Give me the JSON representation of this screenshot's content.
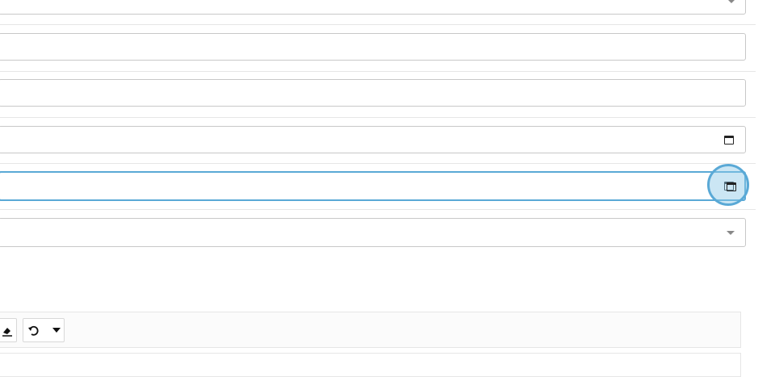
{
  "form": {
    "fields": [
      {
        "type": "select",
        "value": ""
      },
      {
        "type": "text",
        "value": ""
      },
      {
        "type": "text",
        "value": ""
      },
      {
        "type": "date",
        "value": ""
      },
      {
        "type": "date",
        "value": "",
        "focused": true
      },
      {
        "type": "select",
        "value": ""
      }
    ]
  },
  "editor": {
    "toolbar": {
      "icons": [
        "eraser-icon",
        "undo-icon",
        "dropdown-caret-icon"
      ]
    }
  },
  "colors": {
    "focus_border": "#5aa9d6",
    "highlight_fill": "#bfe1f0"
  }
}
